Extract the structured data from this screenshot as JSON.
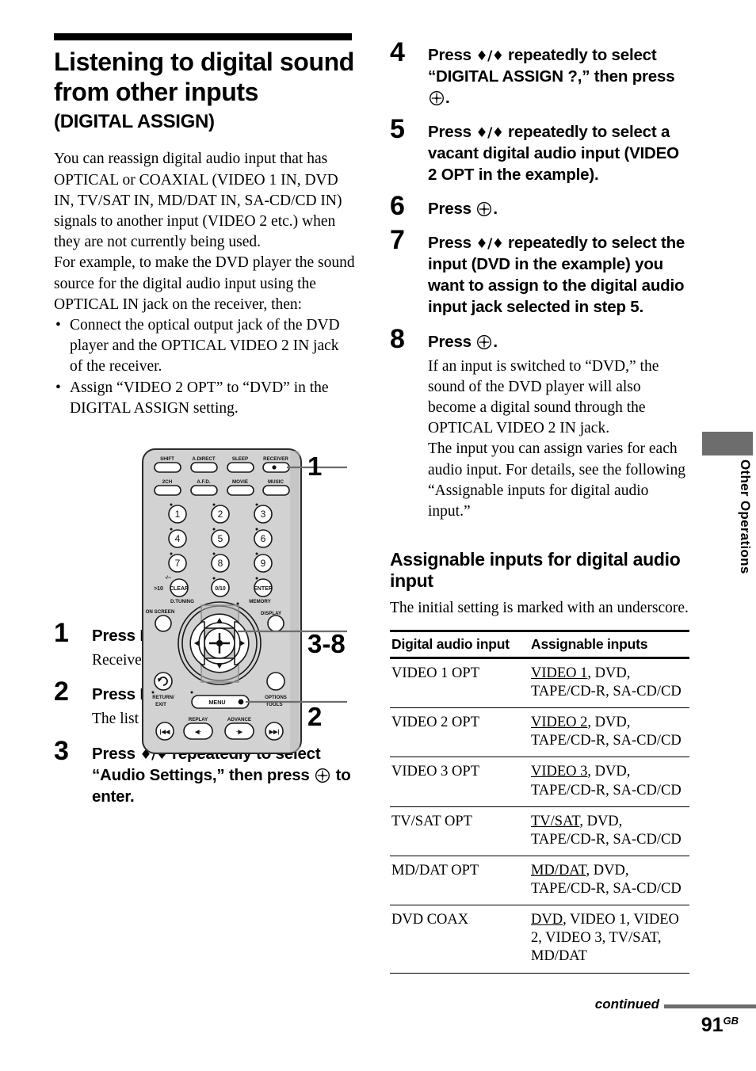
{
  "title": {
    "main": "Listening to digital sound from other inputs",
    "sub": "(DIGITAL ASSIGN)"
  },
  "intro": {
    "paragraph1": "You can reassign digital audio input that has OPTICAL or COAXIAL (VIDEO 1 IN, DVD IN, TV/SAT IN, MD/DAT IN, SA-CD/CD IN) signals to another input (VIDEO 2 etc.) when they are not currently being used.",
    "paragraph2": "For example, to make the DVD player the sound source for the digital audio input using the OPTICAL IN jack on the receiver, then:",
    "bullets": [
      "Connect the optical output jack of the DVD player and the OPTICAL VIDEO 2 IN jack of the receiver.",
      "Assign “VIDEO 2 OPT” to “DVD” in the DIGITAL ASSIGN setting."
    ]
  },
  "figure": {
    "callouts": [
      "1",
      "3-8",
      "2"
    ],
    "buttons": {
      "row1": [
        "SHIFT",
        "A.DIRECT",
        "SLEEP",
        "RECEIVER"
      ],
      "row2": [
        "2CH",
        "A.F.D.",
        "MOVIE",
        "MUSIC"
      ],
      "keypad": [
        "1",
        "2",
        "3",
        "4",
        "5",
        "6",
        "7",
        "8",
        "9"
      ],
      "keypad_bottom": [
        ">10",
        "CLEAR",
        "0/10",
        "ENTER"
      ],
      "dash_label": "-/--",
      "labels_mid": [
        "D.TUNING",
        "MEMORY"
      ],
      "labels_screen": [
        "ON SCREEN",
        "DISPLAY"
      ],
      "labels_lower": [
        "RETURN/",
        "EXIT",
        "MENU",
        "OPTIONS",
        "TOOLS"
      ],
      "labels_transport": [
        "REPLAY",
        "ADVANCE"
      ]
    }
  },
  "steps_left": [
    {
      "num": "1",
      "head_parts": [
        {
          "type": "text",
          "value": "Press RECEIVER."
        }
      ],
      "sub": "Receiver operation is enabled."
    },
    {
      "num": "2",
      "head_parts": [
        {
          "type": "text",
          "value": "Press MENU."
        }
      ],
      "sub": "The list of setting menus appears."
    },
    {
      "num": "3",
      "head_parts": [
        {
          "type": "text",
          "value": "Press "
        },
        {
          "type": "updown",
          "value": "♦/♦"
        },
        {
          "type": "text",
          "value": " repeatedly to select “Audio Settings,” then press "
        },
        {
          "type": "enter",
          "value": "enter-button"
        },
        {
          "type": "text",
          "value": " to enter."
        }
      ],
      "sub": ""
    }
  ],
  "steps_right": [
    {
      "num": "4",
      "head_parts": [
        {
          "type": "text",
          "value": "Press "
        },
        {
          "type": "updown",
          "value": "♦/♦"
        },
        {
          "type": "text",
          "value": " repeatedly to select “DIGITAL ASSIGN ?,” then press "
        },
        {
          "type": "enter",
          "value": "enter-button"
        },
        {
          "type": "text",
          "value": "."
        }
      ],
      "sub": ""
    },
    {
      "num": "5",
      "head_parts": [
        {
          "type": "text",
          "value": "Press "
        },
        {
          "type": "updown",
          "value": "♦/♦"
        },
        {
          "type": "text",
          "value": " repeatedly to select a vacant digital audio input (VIDEO 2 OPT in the example)."
        }
      ],
      "sub": ""
    },
    {
      "num": "6",
      "head_parts": [
        {
          "type": "text",
          "value": "Press "
        },
        {
          "type": "enter",
          "value": "enter-button"
        },
        {
          "type": "text",
          "value": "."
        }
      ],
      "sub": ""
    },
    {
      "num": "7",
      "head_parts": [
        {
          "type": "text",
          "value": "Press "
        },
        {
          "type": "updown",
          "value": "♦/♦"
        },
        {
          "type": "text",
          "value": " repeatedly to select the input (DVD in the example) you want to assign to the digital audio input jack selected in step 5."
        }
      ],
      "sub": ""
    },
    {
      "num": "8",
      "head_parts": [
        {
          "type": "text",
          "value": "Press "
        },
        {
          "type": "enter",
          "value": "enter-button"
        },
        {
          "type": "text",
          "value": "."
        }
      ],
      "sub": "If an input is switched to “DVD,” the sound of the DVD player will also become a digital sound through the OPTICAL VIDEO 2 IN jack.\nThe input you can assign varies for each audio input. For details, see the following “Assignable inputs for digital audio input.”"
    }
  ],
  "assignable": {
    "heading": "Assignable inputs for digital audio input",
    "note": "The initial setting is marked with an underscore.",
    "columns": [
      "Digital audio input",
      "Assignable inputs"
    ],
    "rows": [
      {
        "input": "VIDEO 1 OPT",
        "default": "VIDEO 1",
        "rest": ", DVD, TAPE/CD-R, SA-CD/CD"
      },
      {
        "input": "VIDEO 2 OPT",
        "default": "VIDEO 2",
        "rest": ", DVD, TAPE/CD-R, SA-CD/CD"
      },
      {
        "input": "VIDEO 3 OPT",
        "default": "VIDEO 3",
        "rest": ", DVD, TAPE/CD-R, SA-CD/CD"
      },
      {
        "input": "TV/SAT OPT",
        "default": "TV/SAT",
        "rest": ", DVD, TAPE/CD-R, SA-CD/CD"
      },
      {
        "input": "MD/DAT OPT",
        "default": "MD/DAT",
        "rest": ", DVD, TAPE/CD-R, SA-CD/CD"
      },
      {
        "input": "DVD COAX",
        "default": "DVD",
        "rest": ", VIDEO 1, VIDEO 2, VIDEO 3, TV/SAT, MD/DAT"
      }
    ]
  },
  "side_tab": {
    "label": "Other Operations"
  },
  "footer": {
    "continued": "continued",
    "page": "91",
    "page_suffix": "GB"
  }
}
